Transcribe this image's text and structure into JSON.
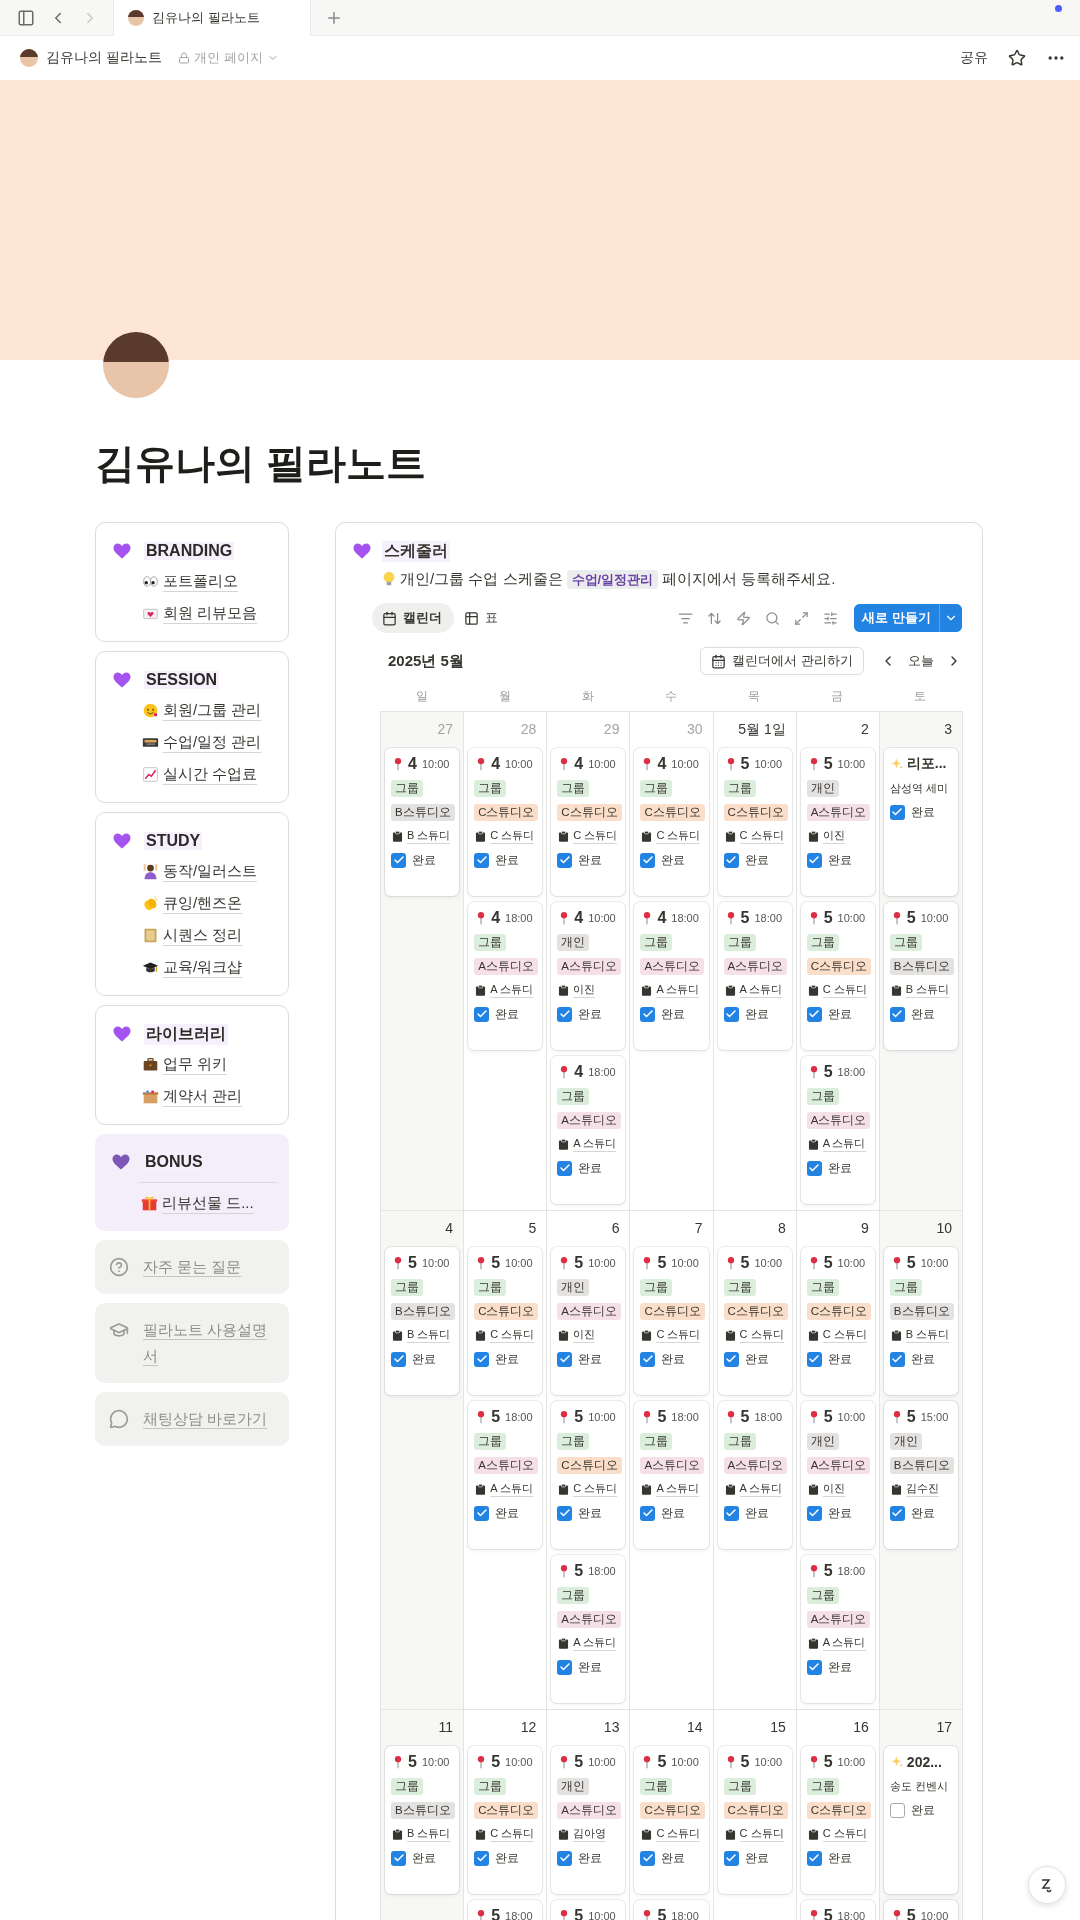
{
  "browser": {
    "tab_title": "김유나의 필라노트"
  },
  "header": {
    "breadcrumb": "김유나의 필라노트",
    "privacy": "개인 페이지",
    "share": "공유"
  },
  "page": {
    "title": "김유나의 필라노트"
  },
  "sidebar": {
    "sections": [
      {
        "kind": "outlined",
        "title": "BRANDING",
        "items": [
          "포트폴리오",
          "회원 리뷰모음"
        ]
      },
      {
        "kind": "outlined",
        "title": "SESSION",
        "items": [
          "회원/그룹 관리",
          "수업/일정 관리",
          "실시간 수업료"
        ]
      },
      {
        "kind": "outlined",
        "title": "STUDY",
        "items": [
          "동작/일러스트",
          "큐잉/핸즈온",
          "시퀀스 정리",
          "교육/워크샵"
        ]
      },
      {
        "kind": "outlined",
        "title": "라이브러리",
        "items": [
          "업무 위키",
          "계약서 관리"
        ]
      },
      {
        "kind": "tinted",
        "title": "BONUS",
        "items": [
          "리뷰선물 드..."
        ]
      }
    ],
    "links": [
      "자주 묻는 질문",
      "필라노트 사용설명서",
      "채팅상담 바로가기"
    ]
  },
  "scheduler": {
    "title": "스케줄러",
    "tip": {
      "before": "개인/그룹 수업 스케줄은",
      "link": "수업/일정관리",
      "after": "페이지에서 등록해주세요."
    },
    "views": [
      {
        "label": "캘린더",
        "selected": true
      },
      {
        "label": "표",
        "selected": false
      }
    ],
    "new_button": "새로 만들기",
    "month": "2025년 5월",
    "manage_button": "캘린더에서 관리하기",
    "today_button": "오늘",
    "weekdays": [
      "일",
      "월",
      "화",
      "수",
      "목",
      "금",
      "토"
    ],
    "weeks": [
      {
        "days": [
          {
            "label": "27",
            "other_month": true,
            "cards": [
              {
                "kind": "session",
                "count": "4",
                "time": "10:00",
                "tags": [
                  {
                    "label": "그룹",
                    "color": "#dbeddb"
                  },
                  {
                    "label": "B스튜디오",
                    "color": "#e3e2e0"
                  }
                ],
                "place": "B 스튜디",
                "status": {
                  "label": "완료",
                  "checked": true
                }
              }
            ]
          },
          {
            "label": "28",
            "other_month": true,
            "cards": [
              {
                "kind": "session",
                "count": "4",
                "time": "10:00",
                "tags": [
                  {
                    "label": "그룹",
                    "color": "#dbeddb"
                  },
                  {
                    "label": "C스튜디오",
                    "color": "#fadec9"
                  }
                ],
                "place": "C 스튜디",
                "status": {
                  "label": "완료",
                  "checked": true
                }
              },
              {
                "kind": "session",
                "count": "4",
                "time": "18:00",
                "tags": [
                  {
                    "label": "그룹",
                    "color": "#dbeddb"
                  },
                  {
                    "label": "A스튜디오",
                    "color": "#f5e0e9"
                  }
                ],
                "place": "A 스튜디",
                "status": {
                  "label": "완료",
                  "checked": true
                }
              }
            ]
          },
          {
            "label": "29",
            "other_month": true,
            "cards": [
              {
                "kind": "session",
                "count": "4",
                "time": "10:00",
                "tags": [
                  {
                    "label": "그룹",
                    "color": "#dbeddb"
                  },
                  {
                    "label": "C스튜디오",
                    "color": "#fadec9"
                  }
                ],
                "place": "C 스튜디",
                "status": {
                  "label": "완료",
                  "checked": true
                }
              },
              {
                "kind": "session",
                "count": "4",
                "time": "10:00",
                "tags": [
                  {
                    "label": "개인",
                    "color": "#e3e2e0"
                  },
                  {
                    "label": "A스튜디오",
                    "color": "#f5e0e9"
                  }
                ],
                "place": "이진",
                "status": {
                  "label": "완료",
                  "checked": true
                }
              },
              {
                "kind": "session",
                "count": "4",
                "time": "18:00",
                "tags": [
                  {
                    "label": "그룹",
                    "color": "#dbeddb"
                  },
                  {
                    "label": "A스튜디오",
                    "color": "#f5e0e9"
                  }
                ],
                "place": "A 스튜디",
                "status": {
                  "label": "완료",
                  "checked": true
                }
              }
            ]
          },
          {
            "label": "30",
            "other_month": true,
            "cards": [
              {
                "kind": "session",
                "count": "4",
                "time": "10:00",
                "tags": [
                  {
                    "label": "그룹",
                    "color": "#dbeddb"
                  },
                  {
                    "label": "C스튜디오",
                    "color": "#fadec9"
                  }
                ],
                "place": "C 스튜디",
                "status": {
                  "label": "완료",
                  "checked": true
                }
              },
              {
                "kind": "session",
                "count": "4",
                "time": "18:00",
                "tags": [
                  {
                    "label": "그룹",
                    "color": "#dbeddb"
                  },
                  {
                    "label": "A스튜디오",
                    "color": "#f5e0e9"
                  }
                ],
                "place": "A 스튜디",
                "status": {
                  "label": "완료",
                  "checked": true
                }
              }
            ]
          },
          {
            "label": "5월 1일",
            "other_month": false,
            "cards": [
              {
                "kind": "session",
                "count": "5",
                "time": "10:00",
                "tags": [
                  {
                    "label": "그룹",
                    "color": "#dbeddb"
                  },
                  {
                    "label": "C스튜디오",
                    "color": "#fadec9"
                  }
                ],
                "place": "C 스튜디",
                "status": {
                  "label": "완료",
                  "checked": true
                }
              },
              {
                "kind": "session",
                "count": "5",
                "time": "18:00",
                "tags": [
                  {
                    "label": "그룹",
                    "color": "#dbeddb"
                  },
                  {
                    "label": "A스튜디오",
                    "color": "#f5e0e9"
                  }
                ],
                "place": "A 스튜디",
                "status": {
                  "label": "완료",
                  "checked": true
                }
              }
            ]
          },
          {
            "label": "2",
            "other_month": false,
            "cards": [
              {
                "kind": "session",
                "count": "5",
                "time": "10:00",
                "tags": [
                  {
                    "label": "개인",
                    "color": "#e3e2e0"
                  },
                  {
                    "label": "A스튜디오",
                    "color": "#f5e0e9"
                  }
                ],
                "place": "이진",
                "status": {
                  "label": "완료",
                  "checked": true
                }
              },
              {
                "kind": "session",
                "count": "5",
                "time": "10:00",
                "tags": [
                  {
                    "label": "그룹",
                    "color": "#dbeddb"
                  },
                  {
                    "label": "C스튜디오",
                    "color": "#fadec9"
                  }
                ],
                "place": "C 스튜디",
                "status": {
                  "label": "완료",
                  "checked": true
                }
              },
              {
                "kind": "session",
                "count": "5",
                "time": "18:00",
                "tags": [
                  {
                    "label": "그룹",
                    "color": "#dbeddb"
                  },
                  {
                    "label": "A스튜디오",
                    "color": "#f5e0e9"
                  }
                ],
                "place": "A 스튜디",
                "status": {
                  "label": "완료",
                  "checked": true
                }
              }
            ]
          },
          {
            "label": "3",
            "other_month": false,
            "cards": [
              {
                "kind": "event",
                "title": "리포...",
                "place": "삼성역 세미",
                "status": {
                  "label": "완료",
                  "checked": true
                }
              },
              {
                "kind": "session",
                "count": "5",
                "time": "10:00",
                "tags": [
                  {
                    "label": "그룹",
                    "color": "#dbeddb"
                  },
                  {
                    "label": "B스튜디오",
                    "color": "#e3e2e0"
                  }
                ],
                "place": "B 스튜디",
                "status": {
                  "label": "완료",
                  "checked": true
                }
              }
            ]
          }
        ]
      },
      {
        "days": [
          {
            "label": "4",
            "other_month": false,
            "cards": [
              {
                "kind": "session",
                "count": "5",
                "time": "10:00",
                "tags": [
                  {
                    "label": "그룹",
                    "color": "#dbeddb"
                  },
                  {
                    "label": "B스튜디오",
                    "color": "#e3e2e0"
                  }
                ],
                "place": "B 스튜디",
                "status": {
                  "label": "완료",
                  "checked": true
                }
              }
            ]
          },
          {
            "label": "5",
            "other_month": false,
            "cards": [
              {
                "kind": "session",
                "count": "5",
                "time": "10:00",
                "tags": [
                  {
                    "label": "그룹",
                    "color": "#dbeddb"
                  },
                  {
                    "label": "C스튜디오",
                    "color": "#fadec9"
                  }
                ],
                "place": "C 스튜디",
                "status": {
                  "label": "완료",
                  "checked": true
                }
              },
              {
                "kind": "session",
                "count": "5",
                "time": "18:00",
                "tags": [
                  {
                    "label": "그룹",
                    "color": "#dbeddb"
                  },
                  {
                    "label": "A스튜디오",
                    "color": "#f5e0e9"
                  }
                ],
                "place": "A 스튜디",
                "status": {
                  "label": "완료",
                  "checked": true
                }
              }
            ]
          },
          {
            "label": "6",
            "other_month": false,
            "cards": [
              {
                "kind": "session",
                "count": "5",
                "time": "10:00",
                "tags": [
                  {
                    "label": "개인",
                    "color": "#e3e2e0"
                  },
                  {
                    "label": "A스튜디오",
                    "color": "#f5e0e9"
                  }
                ],
                "place": "이진",
                "status": {
                  "label": "완료",
                  "checked": true
                }
              },
              {
                "kind": "session",
                "count": "5",
                "time": "10:00",
                "tags": [
                  {
                    "label": "그룹",
                    "color": "#dbeddb"
                  },
                  {
                    "label": "C스튜디오",
                    "color": "#fadec9"
                  }
                ],
                "place": "C 스튜디",
                "status": {
                  "label": "완료",
                  "checked": true
                }
              },
              {
                "kind": "session",
                "count": "5",
                "time": "18:00",
                "tags": [
                  {
                    "label": "그룹",
                    "color": "#dbeddb"
                  },
                  {
                    "label": "A스튜디오",
                    "color": "#f5e0e9"
                  }
                ],
                "place": "A 스튜디",
                "status": {
                  "label": "완료",
                  "checked": true
                }
              }
            ]
          },
          {
            "label": "7",
            "other_month": false,
            "cards": [
              {
                "kind": "session",
                "count": "5",
                "time": "10:00",
                "tags": [
                  {
                    "label": "그룹",
                    "color": "#dbeddb"
                  },
                  {
                    "label": "C스튜디오",
                    "color": "#fadec9"
                  }
                ],
                "place": "C 스튜디",
                "status": {
                  "label": "완료",
                  "checked": true
                }
              },
              {
                "kind": "session",
                "count": "5",
                "time": "18:00",
                "tags": [
                  {
                    "label": "그룹",
                    "color": "#dbeddb"
                  },
                  {
                    "label": "A스튜디오",
                    "color": "#f5e0e9"
                  }
                ],
                "place": "A 스튜디",
                "status": {
                  "label": "완료",
                  "checked": true
                }
              }
            ]
          },
          {
            "label": "8",
            "other_month": false,
            "cards": [
              {
                "kind": "session",
                "count": "5",
                "time": "10:00",
                "tags": [
                  {
                    "label": "그룹",
                    "color": "#dbeddb"
                  },
                  {
                    "label": "C스튜디오",
                    "color": "#fadec9"
                  }
                ],
                "place": "C 스튜디",
                "status": {
                  "label": "완료",
                  "checked": true
                }
              },
              {
                "kind": "session",
                "count": "5",
                "time": "18:00",
                "tags": [
                  {
                    "label": "그룹",
                    "color": "#dbeddb"
                  },
                  {
                    "label": "A스튜디오",
                    "color": "#f5e0e9"
                  }
                ],
                "place": "A 스튜디",
                "status": {
                  "label": "완료",
                  "checked": true
                }
              }
            ]
          },
          {
            "label": "9",
            "other_month": false,
            "cards": [
              {
                "kind": "session",
                "count": "5",
                "time": "10:00",
                "tags": [
                  {
                    "label": "그룹",
                    "color": "#dbeddb"
                  },
                  {
                    "label": "C스튜디오",
                    "color": "#fadec9"
                  }
                ],
                "place": "C 스튜디",
                "status": {
                  "label": "완료",
                  "checked": true
                }
              },
              {
                "kind": "session",
                "count": "5",
                "time": "10:00",
                "tags": [
                  {
                    "label": "개인",
                    "color": "#e3e2e0"
                  },
                  {
                    "label": "A스튜디오",
                    "color": "#f5e0e9"
                  }
                ],
                "place": "이진",
                "status": {
                  "label": "완료",
                  "checked": true
                }
              },
              {
                "kind": "session",
                "count": "5",
                "time": "18:00",
                "tags": [
                  {
                    "label": "그룹",
                    "color": "#dbeddb"
                  },
                  {
                    "label": "A스튜디오",
                    "color": "#f5e0e9"
                  }
                ],
                "place": "A 스튜디",
                "status": {
                  "label": "완료",
                  "checked": true
                }
              }
            ]
          },
          {
            "label": "10",
            "other_month": false,
            "cards": [
              {
                "kind": "session",
                "count": "5",
                "time": "10:00",
                "tags": [
                  {
                    "label": "그룹",
                    "color": "#dbeddb"
                  },
                  {
                    "label": "B스튜디오",
                    "color": "#e3e2e0"
                  }
                ],
                "place": "B 스튜디",
                "status": {
                  "label": "완료",
                  "checked": true
                }
              },
              {
                "kind": "session",
                "count": "5",
                "time": "15:00",
                "tags": [
                  {
                    "label": "개인",
                    "color": "#e3e2e0"
                  },
                  {
                    "label": "B스튜디오",
                    "color": "#e3e2e0"
                  }
                ],
                "place": "김수진",
                "status": {
                  "label": "완료",
                  "checked": true
                }
              }
            ]
          }
        ]
      },
      {
        "days": [
          {
            "label": "11",
            "other_month": false,
            "cards": [
              {
                "kind": "session",
                "count": "5",
                "time": "10:00",
                "tags": [
                  {
                    "label": "그룹",
                    "color": "#dbeddb"
                  },
                  {
                    "label": "B스튜디오",
                    "color": "#e3e2e0"
                  }
                ],
                "place": "B 스튜디",
                "status": {
                  "label": "완료",
                  "checked": true
                }
              }
            ]
          },
          {
            "label": "12",
            "other_month": false,
            "cards": [
              {
                "kind": "session",
                "count": "5",
                "time": "10:00",
                "tags": [
                  {
                    "label": "그룹",
                    "color": "#dbeddb"
                  },
                  {
                    "label": "C스튜디오",
                    "color": "#fadec9"
                  }
                ],
                "place": "C 스튜디",
                "status": {
                  "label": "완료",
                  "checked": true
                }
              },
              {
                "kind": "session",
                "count": "5",
                "time": "18:00"
              }
            ]
          },
          {
            "label": "13",
            "other_month": false,
            "cards": [
              {
                "kind": "session",
                "count": "5",
                "time": "10:00",
                "tags": [
                  {
                    "label": "개인",
                    "color": "#e3e2e0"
                  },
                  {
                    "label": "A스튜디오",
                    "color": "#f5e0e9"
                  }
                ],
                "place": "김아영",
                "status": {
                  "label": "완료",
                  "checked": true
                }
              },
              {
                "kind": "session",
                "count": "5",
                "time": "10:00"
              }
            ]
          },
          {
            "label": "14",
            "other_month": false,
            "cards": [
              {
                "kind": "session",
                "count": "5",
                "time": "10:00",
                "tags": [
                  {
                    "label": "그룹",
                    "color": "#dbeddb"
                  },
                  {
                    "label": "C스튜디오",
                    "color": "#fadec9"
                  }
                ],
                "place": "C 스튜디",
                "status": {
                  "label": "완료",
                  "checked": true
                }
              },
              {
                "kind": "session",
                "count": "5",
                "time": "18:00"
              }
            ]
          },
          {
            "label": "15",
            "other_month": false,
            "cards": [
              {
                "kind": "session",
                "count": "5",
                "time": "10:00",
                "tags": [
                  {
                    "label": "그룹",
                    "color": "#dbeddb"
                  },
                  {
                    "label": "C스튜디오",
                    "color": "#fadec9"
                  }
                ],
                "place": "C 스튜디",
                "status": {
                  "label": "완료",
                  "checked": true
                }
              }
            ]
          },
          {
            "label": "16",
            "other_month": false,
            "cards": [
              {
                "kind": "session",
                "count": "5",
                "time": "10:00",
                "tags": [
                  {
                    "label": "그룹",
                    "color": "#dbeddb"
                  },
                  {
                    "label": "C스튜디오",
                    "color": "#fadec9"
                  }
                ],
                "place": "C 스튜디",
                "status": {
                  "label": "완료",
                  "checked": true
                }
              },
              {
                "kind": "session",
                "count": "5",
                "time": "18:00"
              }
            ]
          },
          {
            "label": "17",
            "other_month": false,
            "cards": [
              {
                "kind": "event",
                "title": "202...",
                "place": "송도 컨벤시",
                "status": {
                  "label": "완료",
                  "checked": false
                }
              },
              {
                "kind": "session",
                "count": "5",
                "time": "10:00"
              }
            ]
          }
        ]
      }
    ]
  }
}
